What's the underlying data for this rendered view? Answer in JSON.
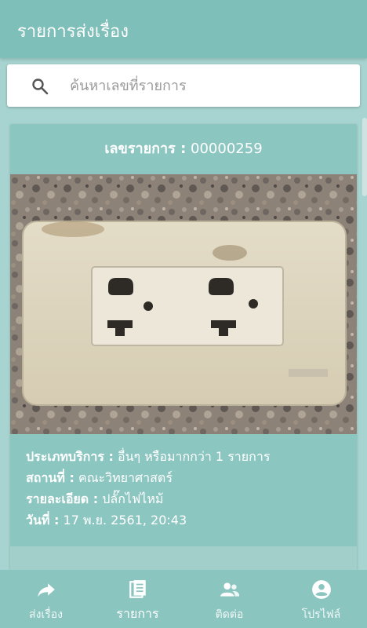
{
  "appbar": {
    "title": "รายการส่งเรื่อง"
  },
  "search": {
    "placeholder": "ค้นหาเลขที่รายการ",
    "icon": "search-icon"
  },
  "card": {
    "header_label": "เลขรายการ :",
    "header_value": "00000259",
    "image_alt": "electrical-outlet-photo",
    "details": [
      {
        "key": "ประเภทบริการ :",
        "value": "อื่นๆ หรือมากกว่า 1 รายการ"
      },
      {
        "key": "สถานที่ :",
        "value": "คณะวิทยาศาสตร์"
      },
      {
        "key": "รายละเอียด :",
        "value": "ปลั๊กไฟไหม้"
      },
      {
        "key": "วันที่ :",
        "value": "17 พ.ย. 2561, 20:43"
      }
    ]
  },
  "bottom_nav": [
    {
      "label": "ส่งเรื่อง",
      "icon": "share-arrow-icon",
      "active": false
    },
    {
      "label": "รายการ",
      "icon": "list-document-icon",
      "active": true
    },
    {
      "label": "ติดต่อ",
      "icon": "contacts-icon",
      "active": false
    },
    {
      "label": "โปรไฟล์",
      "icon": "account-circle-icon",
      "active": false
    }
  ],
  "colors": {
    "primary": "#7fbfb9",
    "background": "#a7d4d0",
    "card": "#8cc6c1",
    "text_on_primary": "#ffffff"
  }
}
